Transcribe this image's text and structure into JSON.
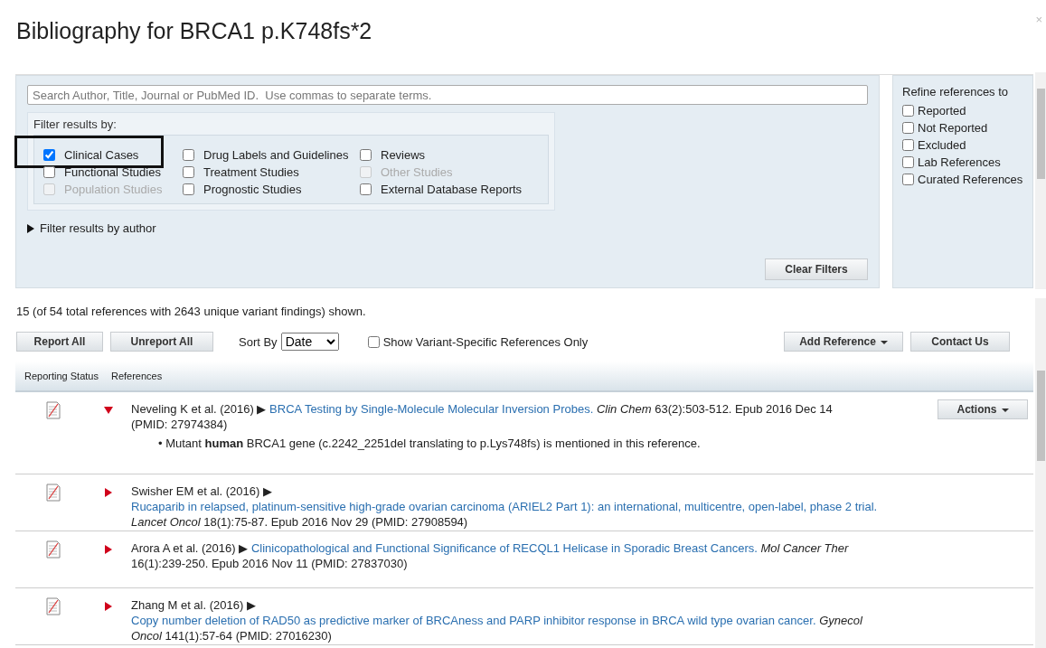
{
  "dialog": {
    "title": "Bibliography for BRCA1 p.K748fs*2",
    "close": "×"
  },
  "filters": {
    "search": {
      "placeholder": "Search Author, Title, Journal or PubMed ID.  Use commas to separate terms."
    },
    "group_label": "Filter results by:",
    "options": [
      {
        "label": "Clinical Cases",
        "checked": true,
        "disabled": false,
        "highlighted": true
      },
      {
        "label": "Drug Labels and Guidelines",
        "checked": false,
        "disabled": false,
        "highlighted": false
      },
      {
        "label": "Reviews",
        "checked": false,
        "disabled": false,
        "highlighted": false
      },
      {
        "label": "Functional Studies",
        "checked": false,
        "disabled": false,
        "highlighted": false
      },
      {
        "label": "Treatment Studies",
        "checked": false,
        "disabled": false,
        "highlighted": false
      },
      {
        "label": "Other Studies",
        "checked": false,
        "disabled": true,
        "highlighted": false
      },
      {
        "label": "Population Studies",
        "checked": false,
        "disabled": true,
        "highlighted": false
      },
      {
        "label": "Prognostic Studies",
        "checked": false,
        "disabled": false,
        "highlighted": false
      },
      {
        "label": "External Database Reports",
        "checked": false,
        "disabled": false,
        "highlighted": false
      }
    ],
    "author_filter": {
      "label": "Filter results by author",
      "expanded": false
    },
    "clear_button": "Clear Filters"
  },
  "refine": {
    "title": "Refine references to",
    "options": [
      {
        "label": "Reported",
        "checked": false
      },
      {
        "label": "Not Reported",
        "checked": false
      },
      {
        "label": "Excluded",
        "checked": false
      },
      {
        "label": "Lab References",
        "checked": false
      },
      {
        "label": "Curated References",
        "checked": false
      }
    ]
  },
  "summary": "15 (of 54 total references with 2643 unique variant findings) shown.",
  "toolbar": {
    "report_all": "Report All",
    "unreport_all": "Unreport All",
    "sort_label": "Sort By",
    "sort_value": "Date",
    "variant_only": {
      "label": "Show Variant-Specific References Only",
      "checked": false
    },
    "add_reference": "Add Reference",
    "contact": "Contact Us"
  },
  "table": {
    "columns": [
      "Reporting Status",
      "References"
    ],
    "rows": [
      {
        "expanded": true,
        "authors": "Neveling K et al. (2016)",
        "marker": "▶",
        "title": "BRCA Testing by Single-Molecule Molecular Inversion Probes.",
        "details": "*Clin Chem* 63(2):503-512. Epub 2016 Dec 14 (PMID: 27974384)",
        "bullet": "•",
        "note": "Mutant **human** BRCA1 gene (c.2242_2251del translating to p.Lys748fs) is mentioned in this reference.",
        "action": "Actions"
      },
      {
        "expanded": false,
        "authors": "Swisher EM et al. (2016)",
        "marker": "▶",
        "title": "Rucaparib in relapsed, platinum-sensitive high-grade ovarian carcinoma (ARIEL2 Part 1): an international, multicentre, open-label, phase 2 trial.",
        "details": "*Lancet Oncol* 18(1):75-87. Epub 2016 Nov 29 (PMID: 27908594)"
      },
      {
        "expanded": false,
        "authors": "Arora A et al. (2016)",
        "marker": "▶",
        "title": "Clinicopathological and Functional Significance of RECQL1 Helicase in Sporadic Breast Cancers.",
        "details": "*Mol Cancer Ther* 16(1):239-250. Epub 2016 Nov 11 (PMID: 27837030)"
      },
      {
        "expanded": false,
        "authors": "Zhang M et al. (2016)",
        "marker": "▶",
        "title": "Copy number deletion of RAD50 as predictive marker of BRCAness and PARP inhibitor response in BRCA wild type ovarian cancer.",
        "details": "*Gynecol Oncol* 141(1):57-64 (PMID: 27016230)"
      }
    ]
  }
}
